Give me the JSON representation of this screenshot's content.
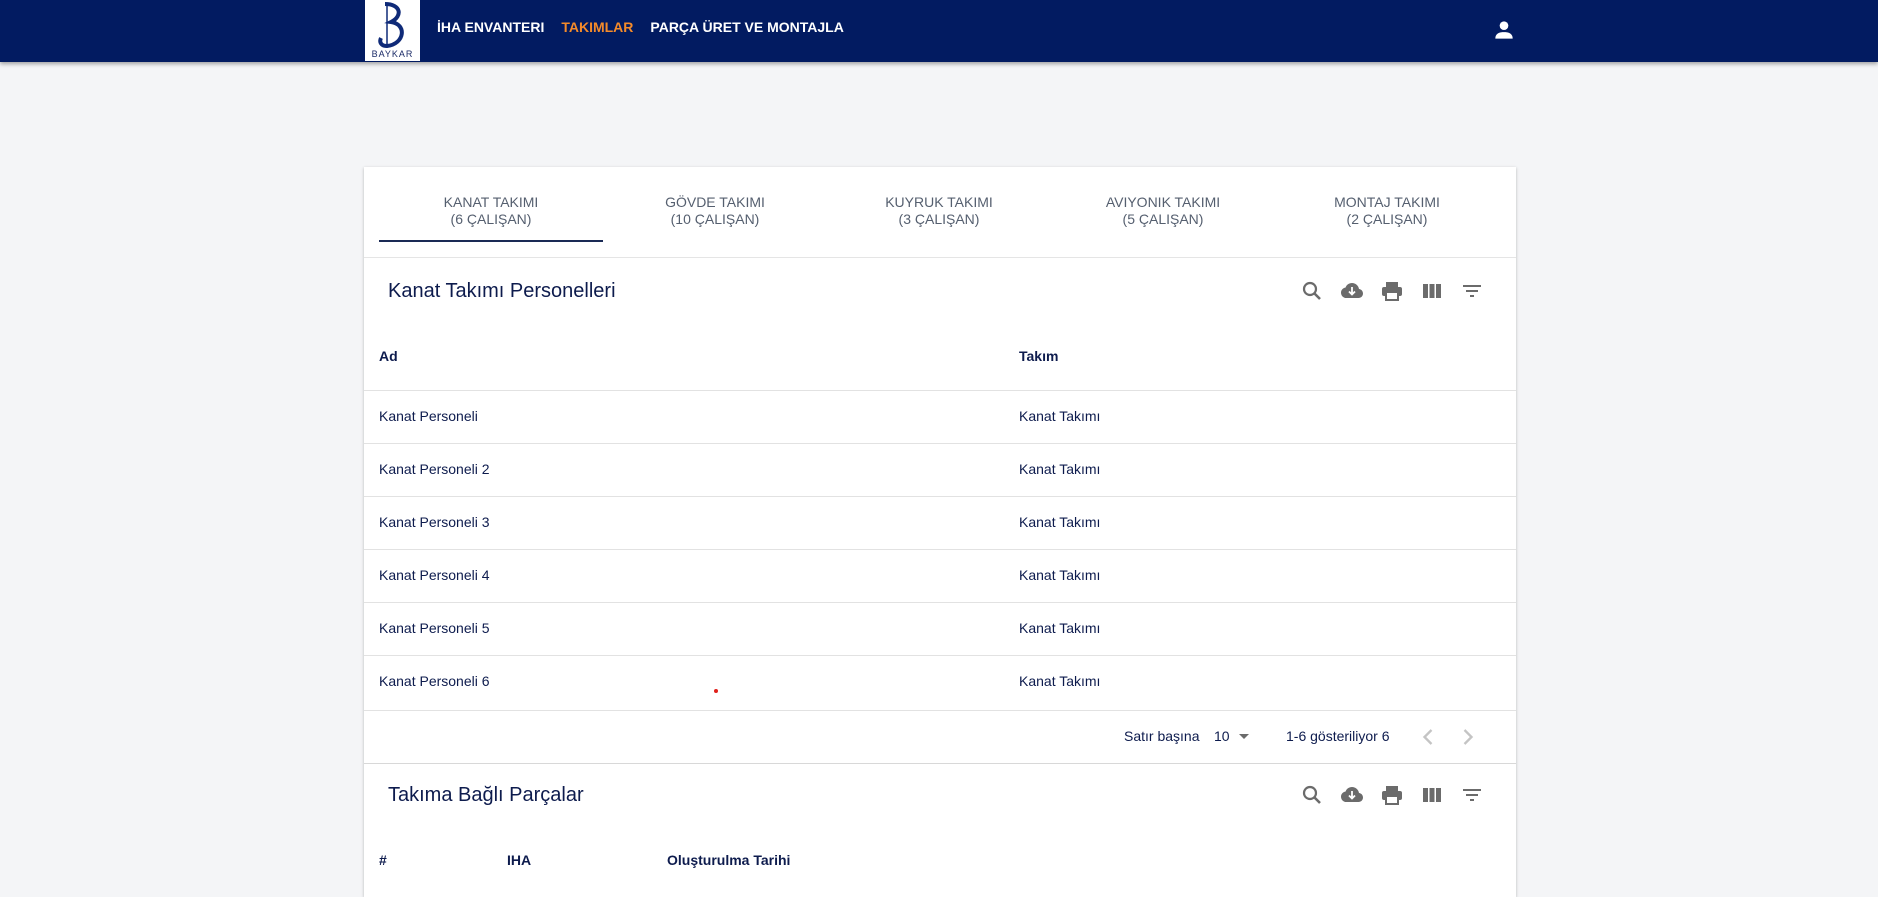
{
  "navbar": {
    "logo_text": "BAYKAR",
    "items": [
      {
        "label": "İHA ENVANTERI",
        "active": false
      },
      {
        "label": "TAKIMLAR",
        "active": true
      },
      {
        "label": "PARÇA ÜRET VE MONTAJLA",
        "active": false
      }
    ],
    "user_icon": "account-icon",
    "colors": {
      "background": "#021b61",
      "active": "#f58b2a"
    }
  },
  "tabs": [
    {
      "name": "KANAT TAKIMI",
      "count": "(6 ÇALIŞAN)",
      "selected": true
    },
    {
      "name": "GÖVDE TAKIMI",
      "count": "(10 ÇALIŞAN)",
      "selected": false
    },
    {
      "name": "KUYRUK TAKIMI",
      "count": "(3 ÇALIŞAN)",
      "selected": false
    },
    {
      "name": "AVIYONIK TAKIMI",
      "count": "(5 ÇALIŞAN)",
      "selected": false
    },
    {
      "name": "MONTAJ TAKIMI",
      "count": "(2 ÇALIŞAN)",
      "selected": false
    }
  ],
  "personnel": {
    "title": "Kanat Takımı Personelleri",
    "toolbar_icons": [
      "search-icon",
      "download-icon",
      "print-icon",
      "columns-icon",
      "filter-icon"
    ],
    "columns": [
      "Ad",
      "Takım"
    ],
    "rows": [
      [
        "Kanat Personeli",
        "Kanat Takımı"
      ],
      [
        "Kanat Personeli 2",
        "Kanat Takımı"
      ],
      [
        "Kanat Personeli 3",
        "Kanat Takımı"
      ],
      [
        "Kanat Personeli 4",
        "Kanat Takımı"
      ],
      [
        "Kanat Personeli 5",
        "Kanat Takımı"
      ],
      [
        "Kanat Personeli 6",
        "Kanat Takımı"
      ]
    ],
    "pagination": {
      "rows_per_page_label": "Satır başına",
      "rows_per_page": "10",
      "range_text": "1-6 gösteriliyor 6"
    }
  },
  "parts": {
    "title": "Takıma Bağlı Parçalar",
    "toolbar_icons": [
      "search-icon",
      "download-icon",
      "print-icon",
      "columns-icon",
      "filter-icon"
    ],
    "columns": [
      "#",
      "IHA",
      "Oluşturulma Tarihi"
    ]
  }
}
